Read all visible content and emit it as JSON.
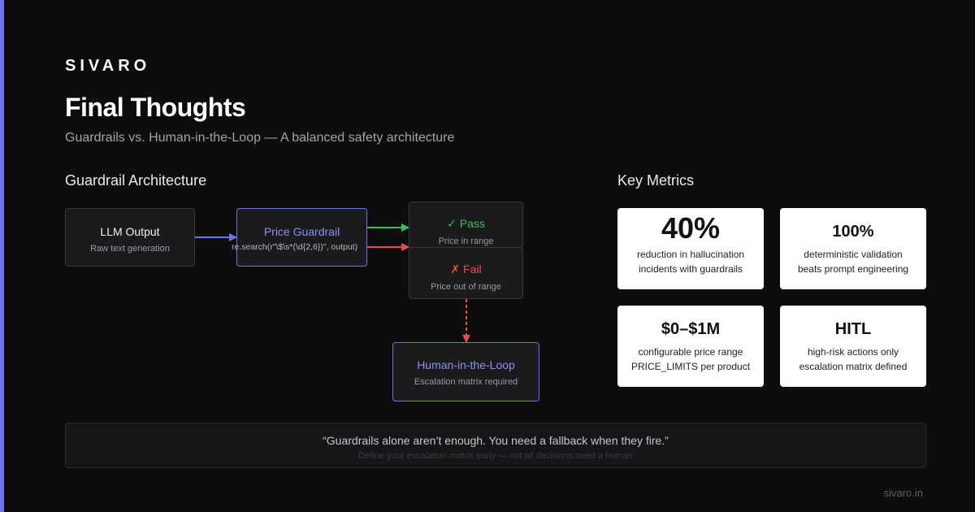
{
  "brand": "SIVARO",
  "title": "Final Thoughts",
  "subtitle": "Guardrails vs. Human-in-the-Loop — A balanced safety architecture",
  "architecture": {
    "heading": "Guardrail Architecture",
    "llm_output": {
      "label": "LLM Output",
      "sub": "Raw text generation"
    },
    "price_guardrail": {
      "label": "Price Guardrail",
      "code": "re.search(r\"\\$\\s*(\\d{2,6})\", output)"
    },
    "pass": {
      "label": "✓ Pass",
      "sub": "Price in range"
    },
    "fail": {
      "label": "✗ Fail",
      "sub": "Price out of range"
    },
    "hitl": {
      "label": "Human-in-the-Loop",
      "sub": "Escalation matrix required"
    },
    "colors": {
      "accent": "#6b74e8",
      "pass": "#2fc15a",
      "fail": "#ee4a4a"
    }
  },
  "metrics": {
    "heading": "Key Metrics",
    "items": [
      {
        "value": "40%",
        "line1": "reduction in hallucination",
        "line2": "incidents with guardrails"
      },
      {
        "value": "100%",
        "line1": "deterministic validation",
        "line2": "beats prompt engineering"
      },
      {
        "value": "$0–$1M",
        "line1": "configurable price range",
        "line2": "PRICE_LIMITS per product"
      },
      {
        "value": "HITL",
        "line1": "high-risk actions only",
        "line2": "escalation matrix defined"
      }
    ]
  },
  "quote": {
    "text": "“Guardrails alone aren’t enough. You need a fallback when they fire.”",
    "sub": "Define your escalation matrix early — not all decisions need a human"
  },
  "footer": {
    "url": "sivaro.in"
  }
}
